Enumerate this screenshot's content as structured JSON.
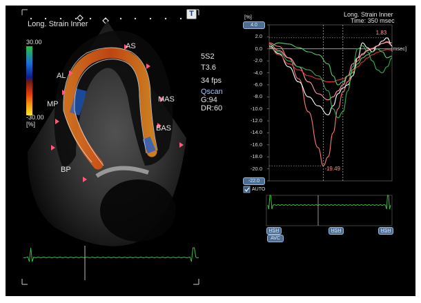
{
  "left_panel": {
    "title": "Long. Strain Inner",
    "t_button": "T",
    "colorbar": {
      "max": "30.00",
      "min": "-30.00",
      "unit": "[%]"
    },
    "segment_labels": [
      "AS",
      "AL",
      "MP",
      "MAS",
      "BAS",
      "BP"
    ],
    "acquisition": {
      "probe": "5S2",
      "tissue": "T3.6",
      "frame_rate": "34 fps",
      "mode": "Qscan",
      "gain": "G:94",
      "dynamic_range": "DR:60"
    }
  },
  "right_panel": {
    "title": "Long. Strain Inner",
    "time_readout": "Time: 350 msec",
    "y_unit": "[%]",
    "x_unit": "[msec]",
    "auto_label": "AUTO",
    "auto_checked": true,
    "buttons": {
      "ava": "AVC",
      "hsh1": "H̲S̲H̲",
      "hsh2": "H̲S̲H̲",
      "hsh3": "H̲S̲H̲"
    }
  },
  "chart_data": {
    "type": "line",
    "ylim": [
      -22,
      4
    ],
    "yticks": [
      "4.0",
      "2.0",
      "0.0",
      "-2.0",
      "-4.0",
      "-6.0",
      "-8.0",
      "-10.0",
      "-12.0",
      "-14.0",
      "-16.0",
      "-18.0",
      "-20.0",
      "-22.0"
    ],
    "x_range_frames": [
      0,
      100
    ],
    "annotations": [
      {
        "text": "1.83",
        "x": 97,
        "y": 1.83,
        "color": "#ff9aa8"
      },
      {
        "text": "-19.49",
        "x": 44,
        "y": -19.49,
        "color": "#ff8c80"
      }
    ],
    "series": [
      {
        "color": "#ff7777",
        "x": [
          0,
          8,
          16,
          24,
          32,
          40,
          44,
          48,
          52,
          56,
          60,
          64,
          68,
          72,
          76,
          80,
          84,
          88,
          92,
          96,
          100
        ],
        "y": [
          1.0,
          0.4,
          -1.5,
          -5.0,
          -10.5,
          -16.5,
          -19.49,
          -18.0,
          -14.0,
          -10.0,
          -7.2,
          -5.5,
          -3.5,
          -2.0,
          -0.8,
          -0.2,
          0.1,
          0.5,
          0.9,
          1.2,
          1.0
        ]
      },
      {
        "color": "#ffffff",
        "x": [
          0,
          8,
          16,
          24,
          32,
          40,
          48,
          52,
          56,
          60,
          64,
          68,
          72,
          76,
          80,
          84,
          88,
          92,
          96,
          100
        ],
        "y": [
          0.5,
          -0.8,
          -3.0,
          -5.5,
          -8.0,
          -9.5,
          -11.0,
          -9.5,
          -7.5,
          -6.5,
          -6.0,
          -4.5,
          -1.5,
          1.0,
          0.2,
          -0.5,
          0.5,
          1.3,
          1.83,
          0.5
        ]
      },
      {
        "color": "#ff9aa8",
        "x": [
          0,
          8,
          16,
          24,
          32,
          40,
          48,
          52,
          56,
          60,
          64,
          68,
          72,
          76,
          80,
          84,
          88,
          92,
          96,
          100
        ],
        "y": [
          0.8,
          -0.3,
          -1.5,
          -3.0,
          -5.5,
          -7.5,
          -8.5,
          -8.0,
          -7.0,
          -6.0,
          -4.5,
          -2.5,
          -1.5,
          -1.0,
          -0.3,
          0.0,
          0.5,
          0.9,
          1.1,
          0.6
        ]
      },
      {
        "color": "#e23a3a",
        "x": [
          0,
          8,
          16,
          24,
          32,
          40,
          48,
          52,
          56,
          60,
          64,
          68,
          72,
          76,
          80,
          84,
          88,
          92,
          96,
          100
        ],
        "y": [
          0.3,
          -1.0,
          -2.5,
          -3.5,
          -4.5,
          -5.0,
          -5.5,
          -5.5,
          -5.2,
          -5.0,
          -4.5,
          -3.8,
          -3.0,
          -2.2,
          -1.5,
          -1.0,
          -0.6,
          -0.3,
          -0.1,
          -0.2
        ]
      },
      {
        "color": "#2fb04e",
        "x": [
          0,
          8,
          16,
          24,
          32,
          40,
          48,
          52,
          56,
          60,
          64,
          68,
          72,
          76,
          80,
          84,
          88,
          92,
          96,
          100
        ],
        "y": [
          0.2,
          -0.5,
          -2.0,
          -3.0,
          -3.5,
          -4.5,
          -7.0,
          -10.0,
          -11.5,
          -10.5,
          -7.0,
          -3.0,
          0.0,
          0.5,
          -0.5,
          -2.0,
          -3.5,
          -4.0,
          -3.0,
          -1.5
        ]
      },
      {
        "color": "#4fd06a",
        "x": [
          0,
          8,
          16,
          24,
          32,
          40,
          48,
          52,
          56,
          60,
          64,
          68,
          72,
          76,
          80,
          84,
          88,
          92,
          96,
          100
        ],
        "y": [
          0.4,
          1.0,
          0.8,
          0.2,
          -0.5,
          -1.0,
          -2.5,
          -4.5,
          -6.0,
          -5.5,
          -4.5,
          -4.0,
          -2.5,
          -1.5,
          -1.0,
          -0.5,
          0.0,
          -0.5,
          -1.5,
          -1.2
        ]
      }
    ],
    "markers_x": [
      44,
      60
    ]
  }
}
